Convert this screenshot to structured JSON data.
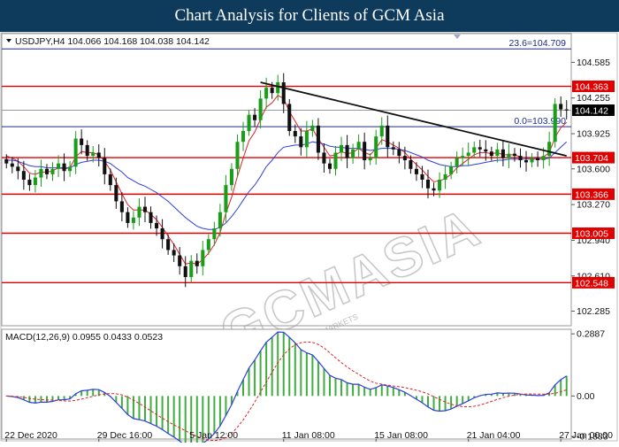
{
  "page_title": "Chart Analysis for Clients of GCM Asia",
  "colors": {
    "header_bg": "#0e3a5c",
    "bull_candle": "#1a9e1a",
    "bear_candle": "#111111",
    "level_line": "#e00000",
    "fib_line": "#1c2a8c",
    "ma_fast": "#e0202a",
    "ma_slow": "#2d3fe0",
    "macd_line": "#2d3fe0",
    "signal_line": "#e0202a",
    "histogram": "#3fae3f",
    "trendline": "#111111"
  },
  "symbol_header": {
    "label": "USDJPY,H4  104.066 104.168 104.038 104.142",
    "menu_icon": "triangle-down-icon"
  },
  "watermark": {
    "text": "GCMASIA",
    "tagline": "GLOBAL CAPITAL MARKETS"
  },
  "price_panel": {
    "y_range": [
      102.15,
      104.85
    ],
    "y_ticks": [
      "104.585",
      "104.255",
      "103.925",
      "103.600",
      "103.270",
      "102.940",
      "102.610",
      "102.285"
    ],
    "current_price": "104.142",
    "horizontal_levels": [
      "104.363",
      "103.704",
      "103.366",
      "103.005",
      "102.548"
    ],
    "fib_levels": [
      {
        "label": "23.6=104.709",
        "price": 104.709
      },
      {
        "label": "0.0=103.990",
        "price": 103.99
      }
    ],
    "trendline": {
      "start": {
        "bar": 44,
        "price": 104.4
      },
      "end": {
        "bar": 97,
        "price": 103.72
      }
    }
  },
  "chart_data": {
    "type": "candlestick",
    "x_labels": [
      "22 Dec 2020",
      "29 Dec 16:00",
      "5 Jan 12:00",
      "11 Jan 08:00",
      "15 Jan 08:00",
      "21 Jan 04:00",
      "27 Jan 00:00"
    ],
    "x_label_bars": [
      0,
      16,
      32,
      48,
      64,
      80,
      96
    ],
    "closes": [
      103.65,
      103.62,
      103.58,
      103.5,
      103.45,
      103.52,
      103.6,
      103.55,
      103.6,
      103.65,
      103.58,
      103.62,
      103.88,
      103.82,
      103.72,
      103.75,
      103.7,
      103.55,
      103.45,
      103.3,
      103.2,
      103.1,
      103.15,
      103.25,
      103.2,
      103.1,
      103.05,
      102.95,
      102.85,
      102.8,
      102.7,
      102.6,
      102.75,
      102.7,
      102.85,
      102.95,
      103.05,
      103.2,
      103.45,
      103.6,
      103.85,
      103.95,
      104.1,
      104.05,
      104.25,
      104.35,
      104.3,
      104.4,
      104.2,
      103.95,
      103.9,
      103.8,
      103.95,
      104.0,
      103.75,
      103.65,
      103.6,
      103.75,
      103.82,
      103.7,
      103.78,
      103.85,
      103.68,
      103.7,
      103.9,
      104.0,
      103.8,
      103.78,
      103.72,
      103.68,
      103.6,
      103.55,
      103.5,
      103.42,
      103.4,
      103.5,
      103.55,
      103.62,
      103.7,
      103.72,
      103.75,
      103.8,
      103.78,
      103.76,
      103.72,
      103.78,
      103.7,
      103.74,
      103.72,
      103.68,
      103.66,
      103.7,
      103.68,
      103.72,
      103.85,
      104.2,
      104.15,
      104.142
    ],
    "series": [
      {
        "name": "MA fast",
        "values": [
          103.72,
          103.7,
          103.67,
          103.62,
          103.56,
          103.55,
          103.57,
          103.57,
          103.58,
          103.61,
          103.6,
          103.61,
          103.71,
          103.76,
          103.75,
          103.75,
          103.73,
          103.67,
          103.59,
          103.48,
          103.37,
          103.27,
          103.22,
          103.22,
          103.22,
          103.18,
          103.13,
          103.06,
          102.98,
          102.9,
          102.81,
          102.72,
          102.73,
          102.72,
          102.76,
          102.82,
          102.9,
          103.01,
          103.19,
          103.34,
          103.53,
          103.7,
          103.86,
          103.94,
          104.06,
          104.17,
          104.21,
          104.28,
          104.25,
          104.13,
          104.04,
          103.95,
          103.95,
          103.97,
          103.88,
          103.8,
          103.72,
          103.73,
          103.76,
          103.74,
          103.75,
          103.79,
          103.75,
          103.73,
          103.79,
          103.87,
          103.85,
          103.82,
          103.79,
          103.75,
          103.69,
          103.64,
          103.59,
          103.53,
          103.48,
          103.49,
          103.51,
          103.55,
          103.61,
          103.65,
          103.69,
          103.73,
          103.75,
          103.75,
          103.74,
          103.75,
          103.73,
          103.73,
          103.73,
          103.71,
          103.7,
          103.7,
          103.7,
          103.71,
          103.75,
          103.89,
          103.98,
          104.03
        ]
      },
      {
        "name": "MA slow",
        "values": [
          103.68,
          103.68,
          103.67,
          103.65,
          103.63,
          103.62,
          103.62,
          103.61,
          103.61,
          103.61,
          103.61,
          103.61,
          103.64,
          103.66,
          103.67,
          103.68,
          103.68,
          103.67,
          103.65,
          103.61,
          103.57,
          103.52,
          103.49,
          103.46,
          103.44,
          103.41,
          103.38,
          103.34,
          103.3,
          103.25,
          103.2,
          103.15,
          103.11,
          103.07,
          103.05,
          103.04,
          103.04,
          103.06,
          103.1,
          103.16,
          103.23,
          103.31,
          103.39,
          103.45,
          103.53,
          103.62,
          103.68,
          103.75,
          103.8,
          103.81,
          103.82,
          103.82,
          103.83,
          103.85,
          103.84,
          103.83,
          103.81,
          103.8,
          103.8,
          103.79,
          103.79,
          103.79,
          103.78,
          103.77,
          103.78,
          103.79,
          103.79,
          103.79,
          103.78,
          103.77,
          103.75,
          103.73,
          103.71,
          103.68,
          103.66,
          103.64,
          103.63,
          103.62,
          103.62,
          103.63,
          103.63,
          103.64,
          103.65,
          103.66,
          103.67,
          103.68,
          103.68,
          103.69,
          103.69,
          103.69,
          103.69,
          103.69,
          103.69,
          103.69,
          103.7,
          103.75,
          103.8,
          103.85
        ]
      }
    ]
  },
  "macd_panel": {
    "label": "MACD(12,26,9) 0.0955 0.0433 0.0523",
    "y_range": [
      -0.2,
      0.31
    ],
    "y_ticks": [
      "0.2887",
      "0.00",
      "-0.1883"
    ]
  }
}
